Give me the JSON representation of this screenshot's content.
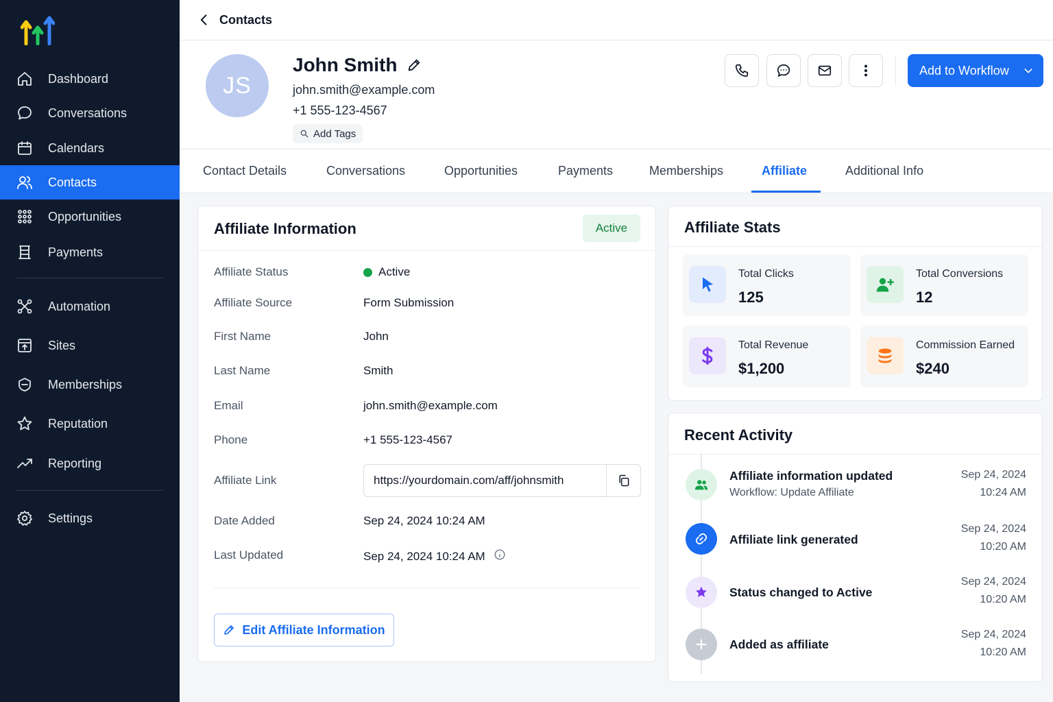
{
  "sidebar": {
    "items": [
      {
        "label": "Dashboard",
        "icon": "home-icon"
      },
      {
        "label": "Conversations",
        "icon": "chat-bubble-icon"
      },
      {
        "label": "Calendars",
        "icon": "calendar-icon"
      },
      {
        "label": "Contacts",
        "icon": "users-icon",
        "active": true
      },
      {
        "label": "Opportunities",
        "icon": "opportunities-icon"
      },
      {
        "label": "Payments",
        "icon": "payments-icon"
      },
      {
        "label": "Automation",
        "icon": "automation-icon"
      },
      {
        "label": "Sites",
        "icon": "sites-icon"
      },
      {
        "label": "Memberships",
        "icon": "memberships-icon"
      },
      {
        "label": "Reputation",
        "icon": "star-icon"
      },
      {
        "label": "Reporting",
        "icon": "trend-icon"
      },
      {
        "label": "Settings",
        "icon": "gear-icon"
      }
    ]
  },
  "topbar": {
    "breadcrumb": "Contacts"
  },
  "contact": {
    "initials": "JS",
    "name": "John Smith",
    "email": "john.smith@example.com",
    "phone": "+1 555-123-4567",
    "add_tags": "Add Tags"
  },
  "actions": {
    "add_to_workflow": "Add to Workflow"
  },
  "tabs": [
    "Contact Details",
    "Conversations",
    "Opportunities",
    "Payments",
    "Memberships",
    "Affiliate",
    "Additional Info"
  ],
  "active_tab": "Affiliate",
  "affiliate_info": {
    "title": "Affiliate Information",
    "badge": "Active",
    "fields": [
      {
        "label": "Affiliate Status",
        "value": "Active"
      },
      {
        "label": "Affiliate Source",
        "value": "Form Submission"
      },
      {
        "label": "First Name",
        "value": "John"
      },
      {
        "label": "Last Name",
        "value": "Smith"
      },
      {
        "label": "Email",
        "value": "john.smith@example.com"
      },
      {
        "label": "Phone",
        "value": "+1 555-123-4567"
      },
      {
        "label": "Affiliate Link",
        "value": "https://yourdomain.com/aff/johnsmith"
      },
      {
        "label": "Date Added",
        "value": "Sep 24, 2024 10:24 AM"
      },
      {
        "label": "Last Updated",
        "value": "Sep 24, 2024 10:24 AM"
      }
    ],
    "edit_button": "Edit Affiliate Information"
  },
  "affiliate_stats": {
    "title": "Affiliate Stats",
    "stats": [
      {
        "label": "Total Clicks",
        "value": "125",
        "icon": "cursor-icon",
        "color": "#1a6cf0",
        "bg": "#e3ecfd"
      },
      {
        "label": "Total Conversions",
        "value": "12",
        "icon": "user-plus-icon",
        "color": "#16a34a",
        "bg": "#dff4e7"
      },
      {
        "label": "Total Revenue",
        "value": "$1,200",
        "icon": "dollar-icon",
        "color": "#7c3aed",
        "bg": "#ede7fb"
      },
      {
        "label": "Commission Earned",
        "value": "$240",
        "icon": "coins-icon",
        "color": "#f97316",
        "bg": "#fdeedf"
      }
    ]
  },
  "recent_activity": {
    "title": "Recent Activity",
    "items": [
      {
        "title": "Affiliate information updated",
        "sub": "Workflow: Update Affiliate",
        "date": "Sep 24, 2024",
        "time": "10:24 AM",
        "icon": "users-icon"
      },
      {
        "title": "Affiliate link generated",
        "sub": "",
        "date": "Sep 24, 2024",
        "time": "10:20 AM",
        "icon": "link-icon"
      },
      {
        "title": "Status changed to Active",
        "sub": "",
        "date": "Sep 24, 2024",
        "time": "10:20 AM",
        "icon": "star-icon"
      },
      {
        "title": "Added as affiliate",
        "sub": "",
        "date": "Sep 24, 2024",
        "time": "10:20 AM",
        "icon": "plus-icon"
      }
    ]
  },
  "colors": {
    "sidebar_bg": "#0f1b2d",
    "accent": "#1a6cf0",
    "active_green": "#16a34a"
  }
}
